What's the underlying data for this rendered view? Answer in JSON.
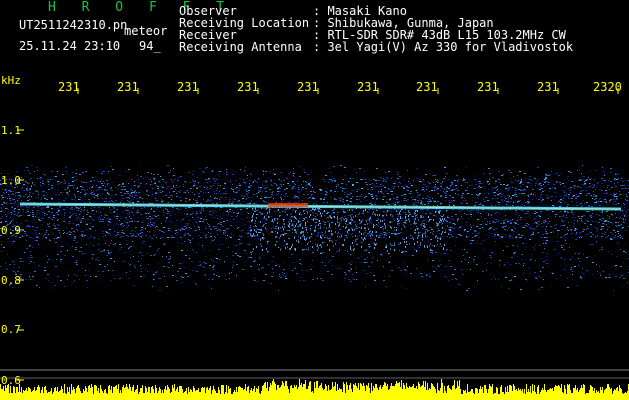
{
  "header": {
    "program": "H R O F F T",
    "filename": "UT2511242310.pn",
    "tag": "meteor",
    "timestamp": "25.11.24 23:10",
    "count": "94_",
    "labels": [
      "Observer",
      "Receiving Location",
      "Receiver",
      "Receiving Antenna"
    ],
    "values": [
      ": Masaki Kano",
      ": Shibukawa, Gunma, Japan",
      ": RTL-SDR SDR# 43dB L15 103.2MHz CW",
      ": 3el Yagi(V) Az 330 for Vladivostok"
    ]
  },
  "axes": {
    "y_unit": "kHz",
    "y_ticks": [
      "1.1",
      "1.0",
      "0.9",
      "0.8",
      "0.7",
      "0.6"
    ],
    "x_ticks": [
      "231",
      "231",
      "231",
      "231",
      "231",
      "231",
      "231",
      "231",
      "231",
      "2320"
    ]
  },
  "colors": {
    "background": "#000000",
    "text": "#ffffff",
    "axis": "#ffff00",
    "title": "#19c24a",
    "signal_core": "#ff3c00",
    "noise": "#1e46d2"
  },
  "icons": []
}
